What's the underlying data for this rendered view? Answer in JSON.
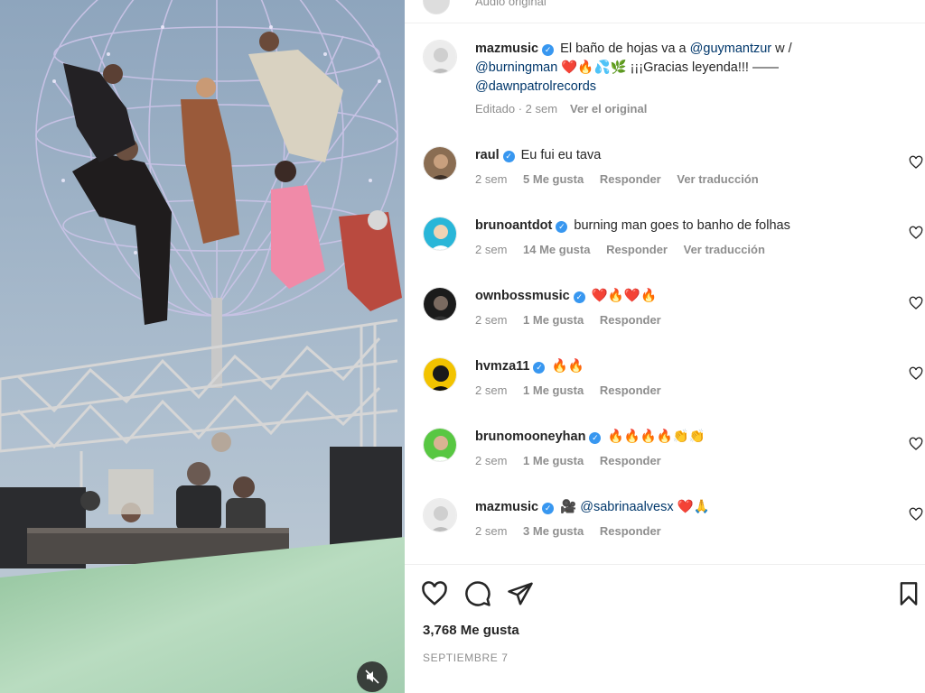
{
  "top_strip": {
    "text": "Audio original"
  },
  "caption": {
    "username": "mazmusic",
    "text_1": "El baño de hojas va a",
    "mention_1": "@guymantzur",
    "text_2": "w /",
    "mention_2": "@burningman",
    "text_3": "❤️🔥💦🌿 ¡¡¡Gracias leyenda!!! ——",
    "mention_3": "@dawnpatrolrecords",
    "edited": "Editado · 2 sem",
    "see_original": "Ver el original"
  },
  "comments": [
    {
      "username": "raul",
      "text": "Eu fui eu tava",
      "time": "2 sem",
      "likes": "5 Me gusta",
      "reply": "Responder",
      "translate": "Ver traducción",
      "avatar_color": "#8a6d52"
    },
    {
      "username": "brunoantdot",
      "text": "burning man goes to banho de folhas",
      "time": "2 sem",
      "likes": "14 Me gusta",
      "reply": "Responder",
      "translate": "Ver traducción",
      "avatar_color": "#29b6d8"
    },
    {
      "username": "ownbossmusic",
      "text": "❤️🔥❤️🔥",
      "time": "2 sem",
      "likes": "1 Me gusta",
      "reply": "Responder",
      "avatar_color": "#1b1b1b"
    },
    {
      "username": "hvmza11",
      "text": "🔥🔥",
      "time": "2 sem",
      "likes": "1 Me gusta",
      "reply": "Responder",
      "avatar_color": "#f2c300"
    },
    {
      "username": "brunomooneyhan",
      "text": "🔥🔥🔥🔥👏👏",
      "time": "2 sem",
      "likes": "1 Me gusta",
      "reply": "Responder",
      "avatar_color": "#58c742"
    },
    {
      "username": "mazmusic",
      "text_pre": "🎥",
      "mention": "@sabrinaalvesx",
      "text_post": "❤️🙏",
      "time": "2 sem",
      "likes": "3 Me gusta",
      "reply": "Responder",
      "avatar_color": "#e8e8e8"
    }
  ],
  "actions": {
    "like_icon": "heart-outline-icon",
    "comment_icon": "comment-bubble-icon",
    "share_icon": "paper-plane-icon",
    "save_icon": "bookmark-icon",
    "likes_count": "3,768 Me gusta",
    "date": "SEPTIEMBRE 7"
  },
  "media": {
    "mute_icon": "speaker-muted-icon"
  }
}
